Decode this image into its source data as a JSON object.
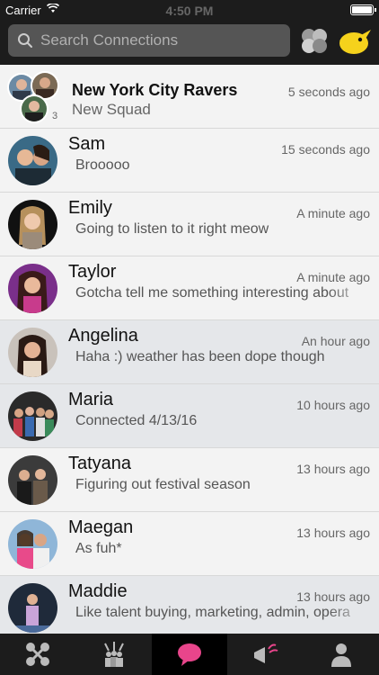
{
  "status_bar": {
    "carrier": "Carrier",
    "time": "4:50 PM"
  },
  "search": {
    "placeholder": "Search Connections",
    "value": ""
  },
  "header": {
    "bubbles_icon": "circles-group-icon",
    "mascot_icon": "yellow-duck-icon"
  },
  "group": {
    "name": "New York City Ravers",
    "subtitle": "New Squad",
    "time": "5 seconds ago",
    "member_count_badge": "3"
  },
  "connections": [
    {
      "name": "Sam",
      "message": "Brooooo",
      "time": "15 seconds ago"
    },
    {
      "name": "Emily",
      "message": "Going to listen to it right meow",
      "time": "A minute ago"
    },
    {
      "name": "Taylor",
      "message": "Gotcha tell me something interesting about",
      "time": "A minute ago"
    },
    {
      "name": "Angelina",
      "message": "Haha :) weather has been dope though",
      "time": "An hour ago"
    },
    {
      "name": "Maria",
      "message": "Connected 4/13/16",
      "time": "10 hours ago"
    },
    {
      "name": "Tatyana",
      "message": "Figuring out festival season",
      "time": "13 hours ago"
    },
    {
      "name": "Maegan",
      "message": "As fuh*",
      "time": "13 hours ago"
    },
    {
      "name": "Maddie",
      "message": "Like talent buying, marketing, admin, opera",
      "time": "13 hours ago"
    }
  ],
  "tabbar": {
    "items": [
      "network-icon",
      "crowd-icon",
      "chat-bubble-icon",
      "megaphone-icon",
      "profile-icon"
    ],
    "active_index": 2,
    "active_color": "#e8458b"
  },
  "colors": {
    "header_bg": "#1c1c1c",
    "mascot": "#f5d21c",
    "accent": "#e8458b"
  }
}
